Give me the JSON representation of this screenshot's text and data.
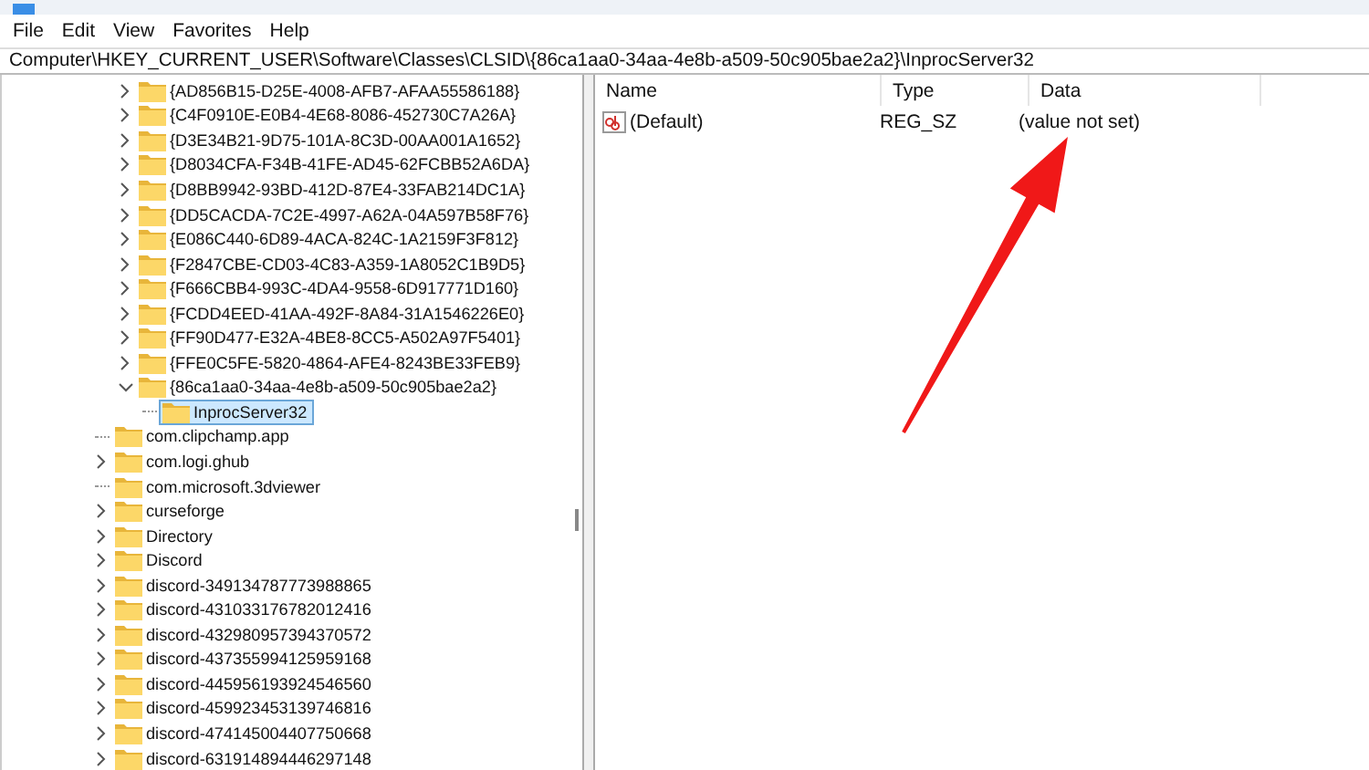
{
  "menu": [
    "File",
    "Edit",
    "View",
    "Favorites",
    "Help"
  ],
  "address": "Computer\\HKEY_CURRENT_USER\\Software\\Classes\\CLSID\\{86ca1aa0-34aa-4e8b-a509-50c905bae2a2}\\InprocServer32",
  "tree": {
    "nested_items": [
      {
        "label": "{AD856B15-D25E-4008-AFB7-AFAA55586188}",
        "has_children": true,
        "expanded": false,
        "selected": false
      },
      {
        "label": "{C4F0910E-E0B4-4E68-8086-452730C7A26A}",
        "has_children": true,
        "expanded": false,
        "selected": false
      },
      {
        "label": "{D3E34B21-9D75-101A-8C3D-00AA001A1652}",
        "has_children": true,
        "expanded": false,
        "selected": false
      },
      {
        "label": "{D8034CFA-F34B-41FE-AD45-62FCBB52A6DA}",
        "has_children": true,
        "expanded": false,
        "selected": false
      },
      {
        "label": "{D8BB9942-93BD-412D-87E4-33FAB214DC1A}",
        "has_children": true,
        "expanded": false,
        "selected": false
      },
      {
        "label": "{DD5CACDA-7C2E-4997-A62A-04A597B58F76}",
        "has_children": true,
        "expanded": false,
        "selected": false
      },
      {
        "label": "{E086C440-6D89-4ACA-824C-1A2159F3F812}",
        "has_children": true,
        "expanded": false,
        "selected": false
      },
      {
        "label": "{F2847CBE-CD03-4C83-A359-1A8052C1B9D5}",
        "has_children": true,
        "expanded": false,
        "selected": false
      },
      {
        "label": "{F666CBB4-993C-4DA4-9558-6D917771D160}",
        "has_children": true,
        "expanded": false,
        "selected": false
      },
      {
        "label": "{FCDD4EED-41AA-492F-8A84-31A1546226E0}",
        "has_children": true,
        "expanded": false,
        "selected": false
      },
      {
        "label": "{FF90D477-E32A-4BE8-8CC5-A502A97F5401}",
        "has_children": true,
        "expanded": false,
        "selected": false
      },
      {
        "label": "{FFE0C5FE-5820-4864-AFE4-8243BE33FEB9}",
        "has_children": true,
        "expanded": false,
        "selected": false
      },
      {
        "label": "{86ca1aa0-34aa-4e8b-a509-50c905bae2a2}",
        "has_children": true,
        "expanded": true,
        "selected": false,
        "children": [
          {
            "label": "InprocServer32",
            "has_children": false,
            "selected": true
          }
        ]
      }
    ],
    "items": [
      {
        "label": "com.clipchamp.app",
        "has_children": false,
        "selected": false
      },
      {
        "label": "com.logi.ghub",
        "has_children": true,
        "expanded": false,
        "selected": false
      },
      {
        "label": "com.microsoft.3dviewer",
        "has_children": false,
        "selected": false
      },
      {
        "label": "curseforge",
        "has_children": true,
        "expanded": false,
        "selected": false
      },
      {
        "label": "Directory",
        "has_children": true,
        "expanded": false,
        "selected": false
      },
      {
        "label": "Discord",
        "has_children": true,
        "expanded": false,
        "selected": false
      },
      {
        "label": "discord-349134787773988865",
        "has_children": true,
        "expanded": false,
        "selected": false
      },
      {
        "label": "discord-431033176782012416",
        "has_children": true,
        "expanded": false,
        "selected": false
      },
      {
        "label": "discord-432980957394370572",
        "has_children": true,
        "expanded": false,
        "selected": false
      },
      {
        "label": "discord-437355994125959168",
        "has_children": true,
        "expanded": false,
        "selected": false
      },
      {
        "label": "discord-445956193924546560",
        "has_children": true,
        "expanded": false,
        "selected": false
      },
      {
        "label": "discord-459923453139746816",
        "has_children": true,
        "expanded": false,
        "selected": false
      },
      {
        "label": "discord-474145004407750668",
        "has_children": true,
        "expanded": false,
        "selected": false
      },
      {
        "label": "discord-631914894446297148",
        "has_children": true,
        "expanded": false,
        "selected": false
      }
    ]
  },
  "values": {
    "columns": [
      "Name",
      "Type",
      "Data"
    ],
    "rows": [
      {
        "name": "(Default)",
        "type": "REG_SZ",
        "data": "(value not set)"
      }
    ]
  }
}
